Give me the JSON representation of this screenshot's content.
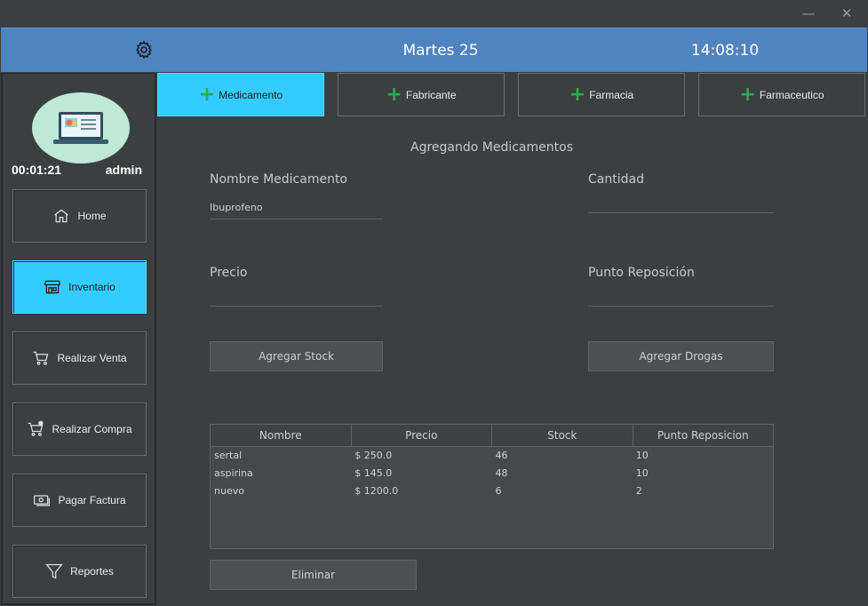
{
  "window": {
    "minimize_glyph": "—",
    "close_glyph": "✕"
  },
  "header": {
    "date": "Martes 25",
    "time": "14:08:10",
    "bg_color": "#4f84c1"
  },
  "sidebar": {
    "session_time": "00:01:21",
    "user": "admin",
    "items": [
      {
        "label": "Home",
        "icon": "home-icon",
        "active": false
      },
      {
        "label": "Inventario",
        "icon": "store-icon",
        "active": true
      },
      {
        "label": "Realizar Venta",
        "icon": "cart-icon",
        "active": false
      },
      {
        "label": "Realizar Compra",
        "icon": "cart-plus-icon",
        "active": false
      },
      {
        "label": "Pagar Factura",
        "icon": "money-icon",
        "active": false
      },
      {
        "label": "Reportes",
        "icon": "filter-icon",
        "active": false
      }
    ],
    "active_color": "#33ccff"
  },
  "tabs": [
    {
      "label": "Medicamento",
      "active": true
    },
    {
      "label": "Fabricante",
      "active": false
    },
    {
      "label": "Farmacia",
      "active": false
    },
    {
      "label": "Farmaceutico",
      "active": false
    }
  ],
  "form": {
    "title": "Agregando Medicamentos",
    "nombre_label": "Nombre Medicamento",
    "nombre_value": "Ibuprofeno",
    "cantidad_label": "Cantidad",
    "cantidad_value": "",
    "precio_label": "Precio",
    "precio_value": "",
    "punto_label": "Punto Reposición",
    "punto_value": "",
    "agregar_stock": "Agregar Stock",
    "agregar_drogas": "Agregar Drogas",
    "eliminar": "Eliminar"
  },
  "table": {
    "columns": [
      "Nombre",
      "Precio",
      "Stock",
      "Punto Reposicion"
    ],
    "rows": [
      [
        "sertal",
        "$ 250.0",
        "46",
        "10"
      ],
      [
        "aspirina",
        "$ 145.0",
        "48",
        "10"
      ],
      [
        "nuevo",
        "$ 1200.0",
        "6",
        "2"
      ]
    ]
  }
}
